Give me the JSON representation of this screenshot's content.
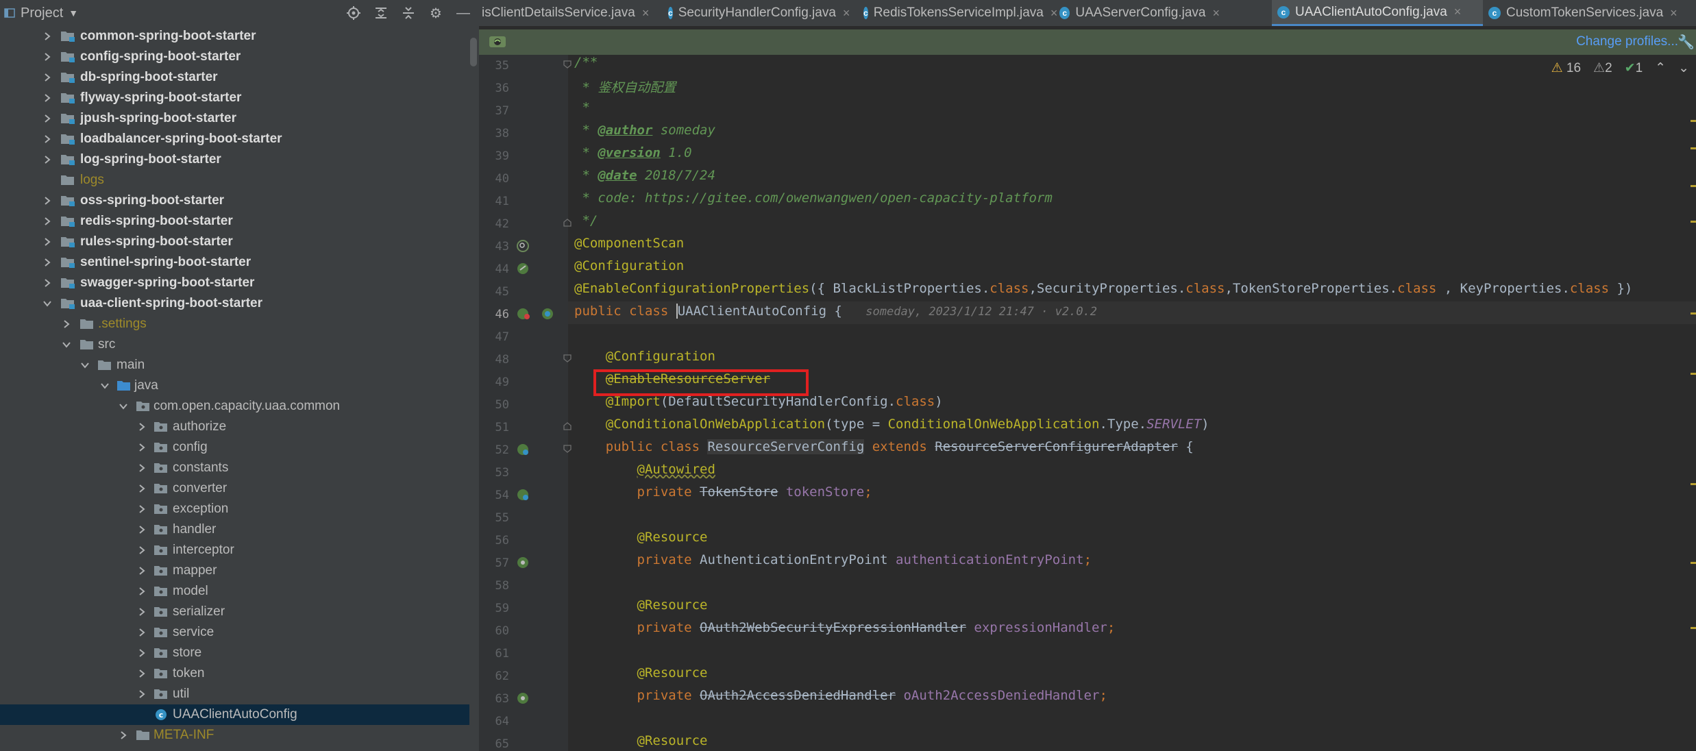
{
  "project_panel": {
    "title": "Project",
    "tree": [
      {
        "label": "common-spring-boot-starter",
        "depth": 0,
        "kind": "module",
        "expanded": false
      },
      {
        "label": "config-spring-boot-starter",
        "depth": 0,
        "kind": "module",
        "expanded": false
      },
      {
        "label": "db-spring-boot-starter",
        "depth": 0,
        "kind": "module",
        "expanded": false
      },
      {
        "label": "flyway-spring-boot-starter",
        "depth": 0,
        "kind": "module",
        "expanded": false
      },
      {
        "label": "jpush-spring-boot-starter",
        "depth": 0,
        "kind": "module",
        "expanded": false
      },
      {
        "label": "loadbalancer-spring-boot-starter",
        "depth": 0,
        "kind": "module",
        "expanded": false
      },
      {
        "label": "log-spring-boot-starter",
        "depth": 0,
        "kind": "module",
        "expanded": false
      },
      {
        "label": "logs",
        "depth": 0,
        "kind": "folder-olive",
        "expanded": null
      },
      {
        "label": "oss-spring-boot-starter",
        "depth": 0,
        "kind": "module",
        "expanded": false
      },
      {
        "label": "redis-spring-boot-starter",
        "depth": 0,
        "kind": "module",
        "expanded": false
      },
      {
        "label": "rules-spring-boot-starter",
        "depth": 0,
        "kind": "module",
        "expanded": false
      },
      {
        "label": "sentinel-spring-boot-starter",
        "depth": 0,
        "kind": "module",
        "expanded": false
      },
      {
        "label": "swagger-spring-boot-starter",
        "depth": 0,
        "kind": "module",
        "expanded": false
      },
      {
        "label": "uaa-client-spring-boot-starter",
        "depth": 0,
        "kind": "module",
        "expanded": true
      },
      {
        "label": ".settings",
        "depth": 1,
        "kind": "folder-olive",
        "expanded": false
      },
      {
        "label": "src",
        "depth": 1,
        "kind": "folder",
        "expanded": true
      },
      {
        "label": "main",
        "depth": 2,
        "kind": "folder",
        "expanded": true
      },
      {
        "label": "java",
        "depth": 3,
        "kind": "folder-blue",
        "expanded": true
      },
      {
        "label": "com.open.capacity.uaa.common",
        "depth": 4,
        "kind": "package",
        "expanded": true
      },
      {
        "label": "authorize",
        "depth": 5,
        "kind": "package",
        "expanded": false
      },
      {
        "label": "config",
        "depth": 5,
        "kind": "package",
        "expanded": false
      },
      {
        "label": "constants",
        "depth": 5,
        "kind": "package",
        "expanded": false
      },
      {
        "label": "converter",
        "depth": 5,
        "kind": "package",
        "expanded": false
      },
      {
        "label": "exception",
        "depth": 5,
        "kind": "package",
        "expanded": false
      },
      {
        "label": "handler",
        "depth": 5,
        "kind": "package",
        "expanded": false
      },
      {
        "label": "interceptor",
        "depth": 5,
        "kind": "package",
        "expanded": false
      },
      {
        "label": "mapper",
        "depth": 5,
        "kind": "package",
        "expanded": false
      },
      {
        "label": "model",
        "depth": 5,
        "kind": "package",
        "expanded": false
      },
      {
        "label": "serializer",
        "depth": 5,
        "kind": "package",
        "expanded": false
      },
      {
        "label": "service",
        "depth": 5,
        "kind": "package",
        "expanded": false
      },
      {
        "label": "store",
        "depth": 5,
        "kind": "package",
        "expanded": false
      },
      {
        "label": "token",
        "depth": 5,
        "kind": "package",
        "expanded": false
      },
      {
        "label": "util",
        "depth": 5,
        "kind": "package",
        "expanded": false
      },
      {
        "label": "UAAClientAutoConfig",
        "depth": 5,
        "kind": "class",
        "expanded": null,
        "selected": true
      },
      {
        "label": "META-INF",
        "depth": 4,
        "kind": "folder-olive",
        "expanded": false
      }
    ]
  },
  "tabs": [
    {
      "label": "isClientDetailsService.java",
      "active": false
    },
    {
      "label": "SecurityHandlerConfig.java",
      "active": false
    },
    {
      "label": "RedisTokensServiceImpl.java",
      "active": false
    },
    {
      "label": "UAAServerConfig.java",
      "active": false
    },
    {
      "label": "UAAClientAutoConfig.java",
      "active": true
    },
    {
      "label": "CustomTokenServices.java",
      "active": false
    }
  ],
  "editor": {
    "change_profiles": "Change profiles...",
    "inspections": {
      "warnings": "16",
      "weak_warnings": "2",
      "typos": "1"
    },
    "inline_hint": "someday, 2023/1/12 21:47 · v2.0.2",
    "line_numbers": [
      "35",
      "36",
      "37",
      "38",
      "39",
      "40",
      "41",
      "42",
      "43",
      "44",
      "45",
      "46",
      "47",
      "48",
      "49",
      "50",
      "51",
      "52",
      "53",
      "54",
      "55",
      "56",
      "57",
      "58",
      "59",
      "60",
      "61",
      "62",
      "63",
      "64",
      "65"
    ],
    "code": {
      "l35": "/**",
      "l36": " * 鉴权自动配置",
      "l37": " *",
      "l38_tag": "@author",
      "l38_val": " someday",
      "l39_tag": "@version",
      "l39_val": " 1.0",
      "l40_tag": "@date",
      "l40_val": " 2018/7/24",
      "l41": " * code: https://gitee.com/owenwangwen/open-capacity-platform",
      "l42": " */",
      "l43": "@ComponentScan",
      "l44": "@Configuration",
      "l45_ann": "@EnableConfigurationProperties",
      "l45_a": "({ BlackListProperties.",
      "l45_b": "class",
      "l45_c": ",SecurityProperties.",
      "l45_d": "class",
      "l45_e": ",TokenStoreProperties.",
      "l45_f": "class",
      "l45_g": " , KeyProperties.",
      "l45_h": "class",
      "l45_i": " })",
      "l46_kw": "public class ",
      "l46_name": "UAAClientAutoConfig",
      "l46_brace": " {",
      "l48": "@Configuration",
      "l49": "@EnableResourceServer",
      "l50_ann": "@Import",
      "l50_rest": "(DefaultSecurityHandlerConfig.",
      "l50_kw": "class",
      "l50_end": ")",
      "l51_ann": "@ConditionalOnWebApplication",
      "l51_a": "(type = ",
      "l51_b": "ConditionalOnWebApplication",
      "l51_c": ".Type.",
      "l51_d": "SERVLET",
      "l51_e": ")",
      "l52_kw": "public class ",
      "l52_name": "ResourceServerConfig",
      "l52_ext": " extends ",
      "l52_parent": "ResourceServerConfigurerAdapter",
      "l52_brace": " {",
      "l53": "@Autowired",
      "l54_kw": "private ",
      "l54_type": "TokenStore",
      "l54_field": " tokenStore",
      "l54_semi": ";",
      "l56": "@Resource",
      "l57_kw": "private ",
      "l57_type": "AuthenticationEntryPoint",
      "l57_field": " authenticationEntryPoint",
      "l57_semi": ";",
      "l59": "@Resource",
      "l60_kw": "private ",
      "l60_type": "OAuth2WebSecurityExpressionHandler",
      "l60_field": " expressionHandler",
      "l60_semi": ";",
      "l62": "@Resource",
      "l63_kw": "private ",
      "l63_type": "OAuth2AccessDeniedHandler",
      "l63_field": " oAuth2AccessDeniedHandler",
      "l63_semi": ";",
      "l65": "@Resource"
    }
  },
  "colors": {
    "accent": "#4a88c7",
    "highlight_box": "#e02020",
    "notification_bar": "#4a5947"
  }
}
